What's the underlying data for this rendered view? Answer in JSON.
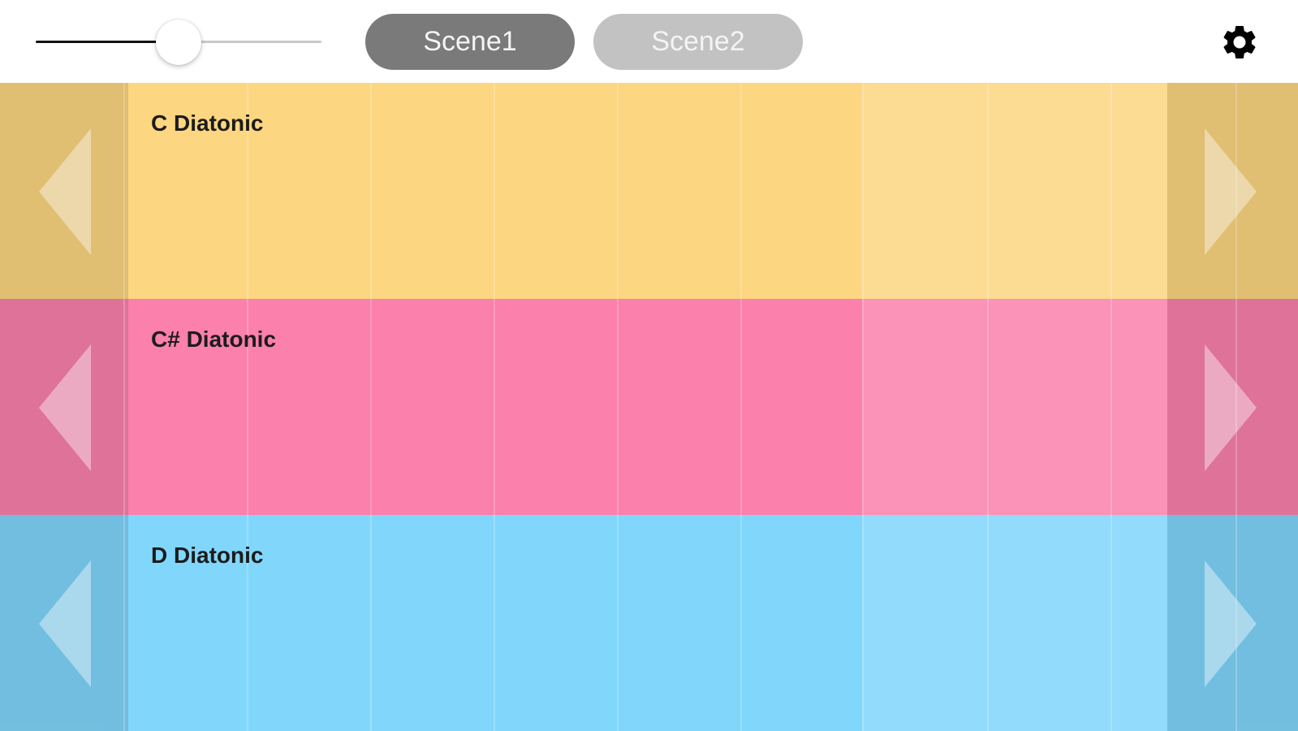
{
  "toolbar": {
    "volume_slider": {
      "value": 0.5
    },
    "scenes": [
      {
        "label": "Scene1",
        "active": true
      },
      {
        "label": "Scene2",
        "active": false
      }
    ],
    "settings_icon": "gear-icon"
  },
  "rows": [
    {
      "label": "C Diatonic",
      "color": "#fcd681"
    },
    {
      "label": "C# Diatonic",
      "color": "#fb80ac"
    },
    {
      "label": "D Diatonic",
      "color": "#81d6fc"
    }
  ],
  "icons": {
    "left": "chevron-left-icon",
    "right": "chevron-right-icon"
  }
}
